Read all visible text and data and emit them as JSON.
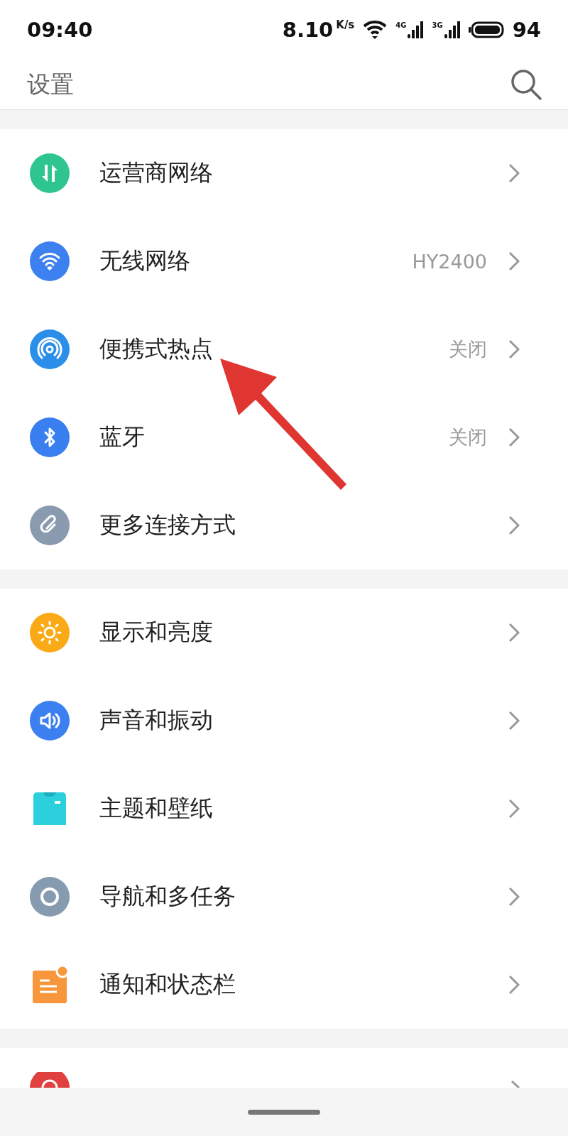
{
  "status_bar": {
    "time": "09:40",
    "speed": "8.10",
    "speed_unit": "K/s",
    "signals": [
      "4G",
      "3G"
    ],
    "battery": "94"
  },
  "header": {
    "title": "设置"
  },
  "sections": [
    {
      "items": [
        {
          "label": "运营商网络",
          "color": "#2fc58f"
        },
        {
          "label": "无线网络",
          "value": "HY2400",
          "color": "#3d80f0"
        },
        {
          "label": "便携式热点",
          "value": "关闭",
          "color": "#2b8fea"
        },
        {
          "label": "蓝牙",
          "value": "关闭",
          "color": "#3a7ff0"
        },
        {
          "label": "更多连接方式",
          "color": "#8a9bb0"
        }
      ]
    },
    {
      "items": [
        {
          "label": "显示和亮度",
          "color": "#fbaa17"
        },
        {
          "label": "声音和振动",
          "color": "#3b7ff0"
        },
        {
          "label": "主题和壁纸",
          "color": "#2ccfdc"
        },
        {
          "label": "导航和多任务",
          "color": "#869bb0"
        },
        {
          "label": "通知和状态栏",
          "color": "#f7963a"
        }
      ]
    },
    {
      "items": [
        {
          "color": "#e04040"
        }
      ]
    }
  ]
}
